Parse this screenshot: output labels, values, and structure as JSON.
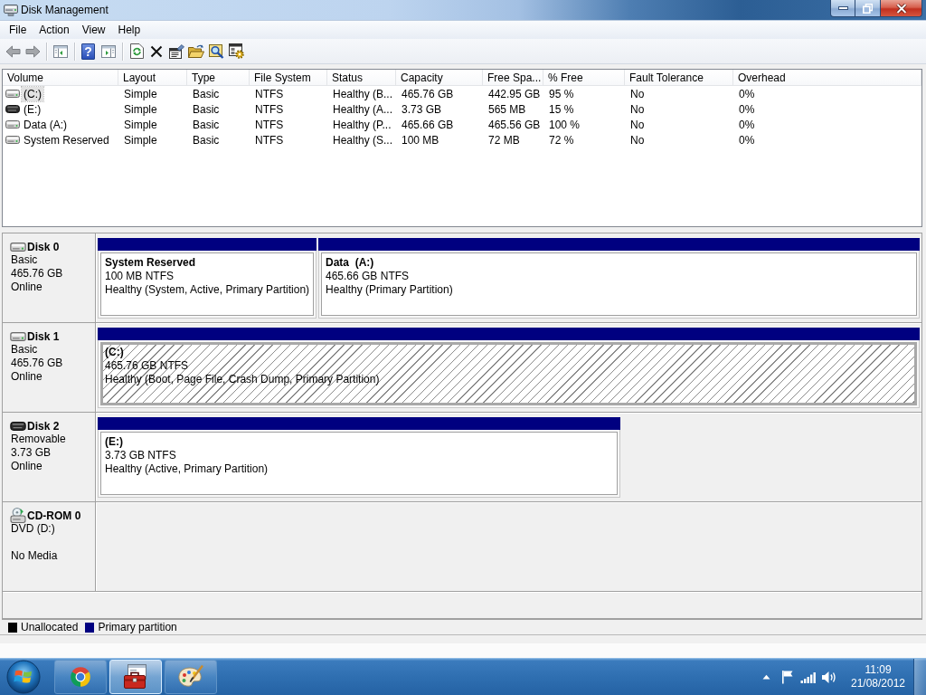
{
  "window": {
    "title": "Disk Management"
  },
  "menu": [
    "File",
    "Action",
    "View",
    "Help"
  ],
  "toolbar": {
    "help_label": "?"
  },
  "volume_list": {
    "columns": [
      "Volume",
      "Layout",
      "Type",
      "File System",
      "Status",
      "Capacity",
      "Free Spa...",
      "% Free",
      "Fault Tolerance",
      "Overhead"
    ],
    "rows": [
      {
        "kind": "fixed",
        "selected": true,
        "cells": [
          "(C:)",
          "Simple",
          "Basic",
          "NTFS",
          "Healthy (B...",
          "465.76 GB",
          "442.95 GB",
          "95 %",
          "No",
          "0%"
        ]
      },
      {
        "kind": "removable",
        "selected": false,
        "cells": [
          "(E:)",
          "Simple",
          "Basic",
          "NTFS",
          "Healthy (A...",
          "3.73 GB",
          "565 MB",
          "15 %",
          "No",
          "0%"
        ]
      },
      {
        "kind": "fixed",
        "selected": false,
        "cells": [
          "Data (A:)",
          "Simple",
          "Basic",
          "NTFS",
          "Healthy (P...",
          "465.66 GB",
          "465.56 GB",
          "100 %",
          "No",
          "0%"
        ]
      },
      {
        "kind": "fixed",
        "selected": false,
        "cells": [
          "System Reserved",
          "Simple",
          "Basic",
          "NTFS",
          "Healthy (S...",
          "100 MB",
          "72 MB",
          "72 %",
          "No",
          "0%"
        ]
      }
    ]
  },
  "disks": [
    {
      "kind": "fixed",
      "name": "Disk 0",
      "type": "Basic",
      "size": "465.76 GB",
      "status": "Online",
      "partitions": [
        {
          "kind": "primary",
          "selected": false,
          "name": "System Reserved",
          "detail": "100 MB NTFS",
          "status": "Healthy (System, Active, Primary Partition)"
        },
        {
          "kind": "primary",
          "selected": false,
          "name": "Data  (A:)",
          "detail": "465.66 GB NTFS",
          "status": "Healthy (Primary Partition)"
        }
      ]
    },
    {
      "kind": "fixed",
      "name": "Disk 1",
      "type": "Basic",
      "size": "465.76 GB",
      "status": "Online",
      "partitions": [
        {
          "kind": "primary",
          "selected": true,
          "name": "(C:)",
          "detail": "465.76 GB NTFS",
          "status": "Healthy (Boot, Page File, Crash Dump, Primary Partition)"
        }
      ]
    },
    {
      "kind": "removable",
      "name": "Disk 2",
      "type": "Removable",
      "size": "3.73 GB",
      "status": "Online",
      "partitions": [
        {
          "kind": "primary",
          "selected": false,
          "name": "(E:)",
          "detail": "3.73 GB NTFS",
          "status": "Healthy (Active, Primary Partition)"
        }
      ]
    },
    {
      "kind": "cdrom",
      "name": "CD-ROM 0",
      "type": "DVD (D:)",
      "status": "No Media"
    }
  ],
  "legend": [
    {
      "label": "Unallocated",
      "color": "#000000"
    },
    {
      "label": "Primary partition",
      "color": "#000080"
    }
  ],
  "taskbar": {
    "apps": [
      {
        "selected": false
      },
      {
        "selected": true
      },
      {
        "selected": false
      }
    ],
    "clock": {
      "time": "11:09",
      "date": "21/08/2012"
    }
  }
}
